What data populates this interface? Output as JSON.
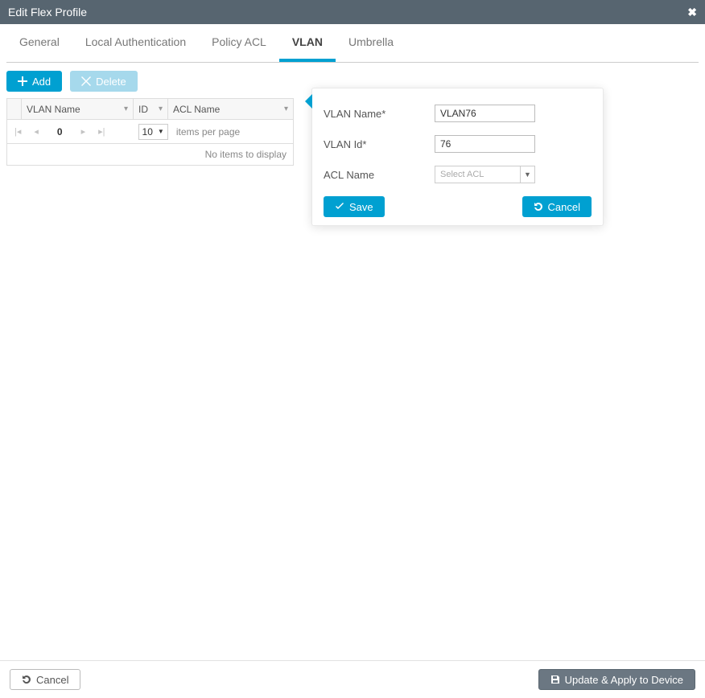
{
  "header": {
    "title": "Edit Flex Profile"
  },
  "tabs": [
    {
      "label": "General"
    },
    {
      "label": "Local Authentication"
    },
    {
      "label": "Policy ACL"
    },
    {
      "label": "VLAN"
    },
    {
      "label": "Umbrella"
    }
  ],
  "toolbar": {
    "add_label": "Add",
    "delete_label": "Delete"
  },
  "table": {
    "columns": {
      "vlan_name": "VLAN Name",
      "id": "ID",
      "acl_name": "ACL Name"
    },
    "no_items": "No items to display"
  },
  "pager": {
    "current": "0",
    "page_size": "10",
    "items_per_page": "items per page"
  },
  "popover": {
    "fields": {
      "vlan_name_label": "VLAN Name*",
      "vlan_name_value": "VLAN76",
      "vlan_id_label": "VLAN Id*",
      "vlan_id_value": "76",
      "acl_name_label": "ACL Name",
      "acl_placeholder": "Select ACL"
    },
    "save_label": "Save",
    "cancel_label": "Cancel"
  },
  "footer": {
    "cancel_label": "Cancel",
    "apply_label": "Update & Apply to Device"
  }
}
